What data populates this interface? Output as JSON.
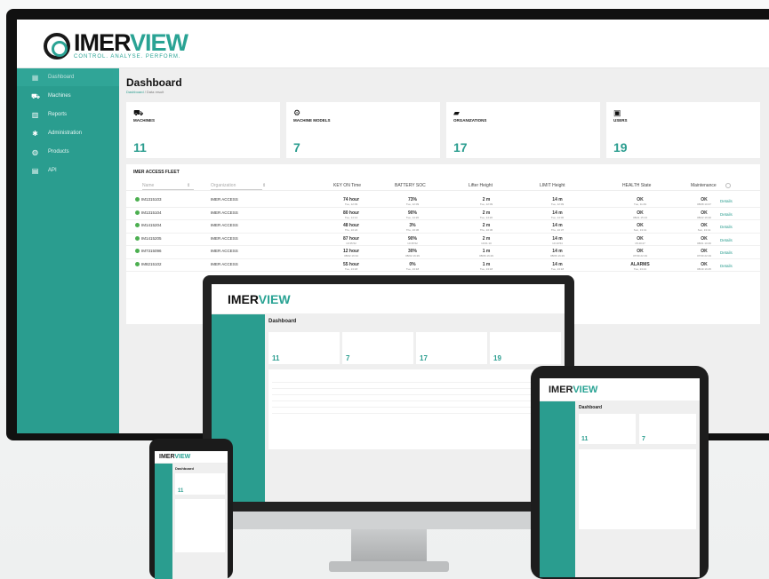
{
  "app": {
    "logo_word": "IMER",
    "logo_word_accent": "VIEW",
    "tagline": "CONTROL. ANALYSE. PERFORM."
  },
  "sidebar": {
    "items": [
      {
        "label": "Dashboard",
        "icon": "grid-icon",
        "active": true
      },
      {
        "label": "Machines",
        "icon": "forklift-icon",
        "active": false
      },
      {
        "label": "Reports",
        "icon": "bar-chart-icon",
        "active": false
      },
      {
        "label": "Administration",
        "icon": "gear-icon",
        "active": false
      },
      {
        "label": "Products",
        "icon": "globe-icon",
        "active": false
      },
      {
        "label": "API",
        "icon": "document-icon",
        "active": false
      }
    ]
  },
  "page": {
    "title": "Dashboard",
    "breadcrumb_home": "Dashboard",
    "breadcrumb_current": "Data result"
  },
  "cards": [
    {
      "label": "MACHINES",
      "value": "11",
      "icon": "forklift-icon"
    },
    {
      "label": "MACHINE MODELS",
      "value": "7",
      "icon": "models-icon"
    },
    {
      "label": "ORGANIZATIONS",
      "value": "17",
      "icon": "folder-icon"
    },
    {
      "label": "USERS",
      "value": "19",
      "icon": "user-icon"
    }
  ],
  "fleet": {
    "title": "IMER ACCESS FLEET",
    "filters": {
      "name": "Name",
      "organization": "Organization"
    },
    "columns": [
      "KEY ON Time",
      "BATTERY SOC",
      "Lifter Height",
      "LIMIT Height",
      "HEALTH State",
      "Maintenance"
    ],
    "rows": [
      {
        "name": "IM1315103",
        "org": "IMER ACCESS",
        "key_on": "74 hour",
        "key_on_sub": "Tue, 12:09",
        "soc": "73%",
        "soc_sub": "Tue, 12:09",
        "lift": "2 m",
        "lift_sub": "Tue, 12:09",
        "limit": "14 m",
        "limit_sub": "Tue, 12:09",
        "health": "OK",
        "health_sub": "Tue, 11:49",
        "maint": "OK",
        "maint_sub": "08/08 10:47",
        "link": "Details"
      },
      {
        "name": "IM1315104",
        "org": "IMER ACCESS",
        "key_on": "80 hour",
        "key_on_sub": "Tue, 14:14",
        "soc": "90%",
        "soc_sub": "Tue, 14:20",
        "lift": "2 m",
        "lift_sub": "Tue, 14:20",
        "limit": "14 m",
        "limit_sub": "Tue, 14:00",
        "health": "OK",
        "health_sub": "08/21 15:13",
        "maint": "OK",
        "maint_sub": "08/22 16:20",
        "link": "Details"
      },
      {
        "name": "IM1415204",
        "org": "IMER ACCESS",
        "key_on": "48 hour",
        "key_on_sub": "Thu, 10:24",
        "soc": "3%",
        "soc_sub": "Thu, 16:36",
        "lift": "2 m",
        "lift_sub": "Thu, 10:36",
        "limit": "14 m",
        "limit_sub": "Thu, 10:37",
        "health": "OK",
        "health_sub": "Sun, 13:41",
        "maint": "OK",
        "maint_sub": "Sun, 13:41",
        "link": "Details"
      },
      {
        "name": "IM1415205",
        "org": "IMER ACCESS",
        "key_on": "87 hour",
        "key_on_sub": "10:35:52",
        "soc": "90%",
        "soc_sub": "10:35:52",
        "lift": "2 m",
        "lift_sub": "10:01:10",
        "limit": "14 m",
        "limit_sub": "10:10:54",
        "health": "OK",
        "health_sub": "15:40:27",
        "maint": "OK",
        "maint_sub": "08/01 10:46",
        "link": "Details"
      },
      {
        "name": "IM7315096",
        "org": "IMER ACCESS",
        "key_on": "12 hour",
        "key_on_sub": "08/02 16:34",
        "soc": "30%",
        "soc_sub": "08/02 16:29",
        "lift": "1 m",
        "lift_sub": "08/06 16:29",
        "limit": "14 m",
        "limit_sub": "08/06 16:29",
        "health": "OK",
        "health_sub": "07/30 22:19",
        "maint": "OK",
        "maint_sub": "07/30 22:19",
        "link": "Details"
      },
      {
        "name": "IM8215102",
        "org": "IMER ACCESS",
        "key_on": "55 hour",
        "key_on_sub": "Tue, 13:18",
        "soc": "0%",
        "soc_sub": "Tue, 13:18",
        "lift": "1 m",
        "lift_sub": "Tue, 13:18",
        "limit": "14 m",
        "limit_sub": "Tue, 13:18",
        "health": "ALARMS",
        "health_sub": "Tue, 13:21",
        "maint": "OK",
        "maint_sub": "08/19 16:25",
        "link": "Details"
      }
    ]
  },
  "colors": {
    "brand": "#2a9d8f",
    "ok_dot": "#4caf50"
  }
}
